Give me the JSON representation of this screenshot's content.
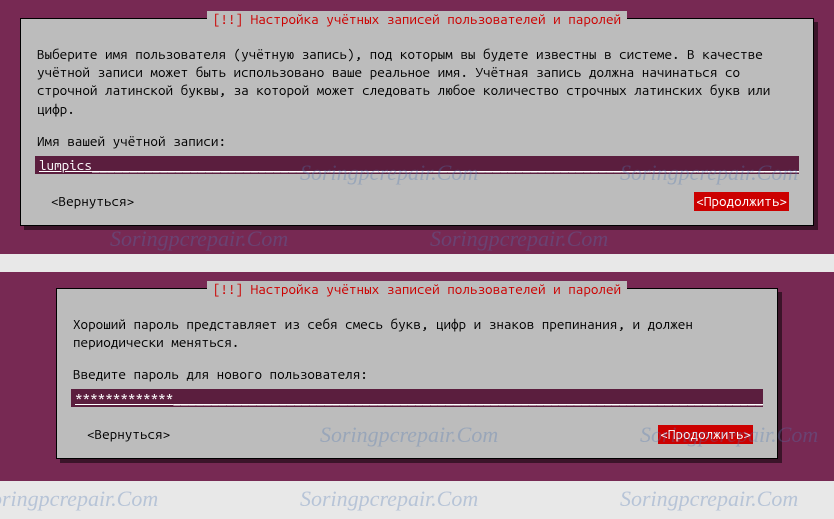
{
  "watermark": "Soringpcrepair.Com",
  "dialog1": {
    "title": "[!!] Настройка учётных записей пользователей и паролей",
    "body": "Выберите имя пользователя (учётную запись), под которым вы будете известны в системе. В качестве учётной записи может быть использовано ваше реальное имя. Учётная запись должна начинаться со строчной латинской буквы, за которой может следовать любое количество строчных латинских букв или цифр.",
    "prompt": "Имя вашей учётной записи:",
    "input_value": "lumpics",
    "back_label": "<Вернуться>",
    "continue_label": "<Продолжить>"
  },
  "dialog2": {
    "title": "[!!] Настройка учётных записей пользователей и паролей",
    "body": "Хороший пароль представляет из себя смесь букв, цифр и знаков препинания, и должен периодически меняться.",
    "prompt": "Введите пароль для нового пользователя:",
    "input_value": "*************",
    "back_label": "<Вернуться>",
    "continue_label": "<Продолжить>"
  }
}
